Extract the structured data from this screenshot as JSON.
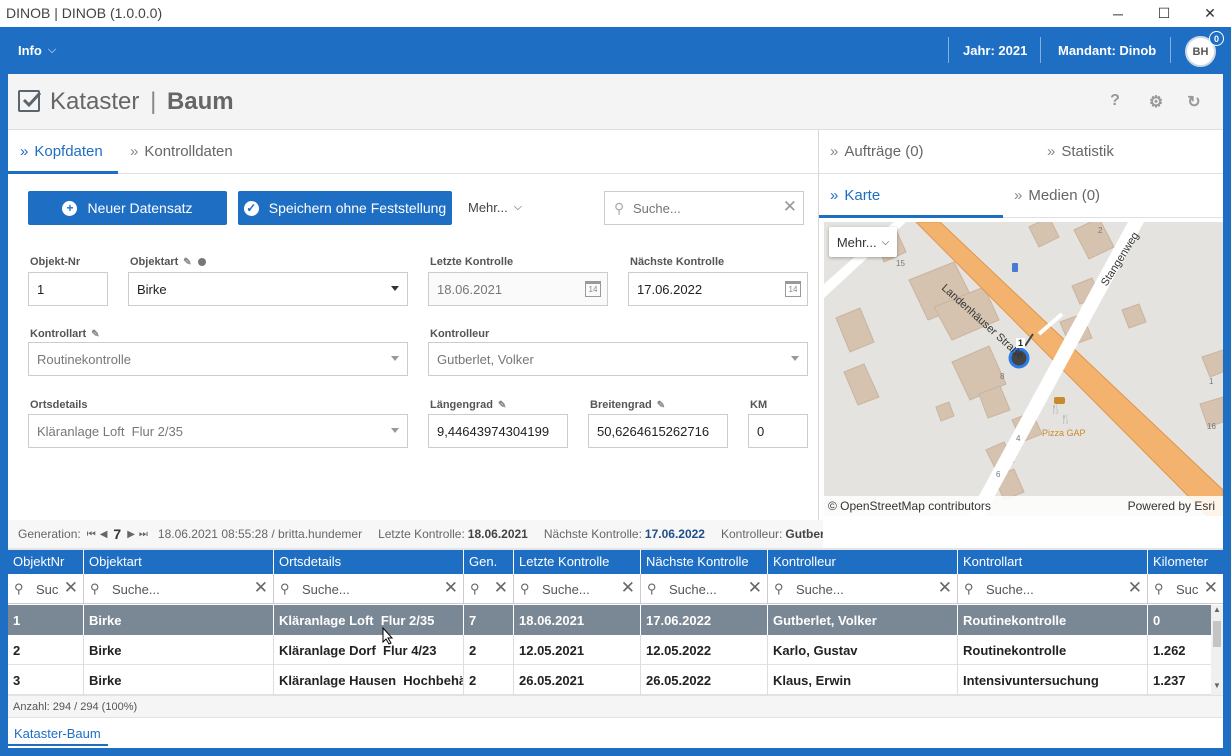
{
  "window": {
    "title": "DINOB | DINOB (1.0.0.0)",
    "minimize": "─",
    "maximize": "☐",
    "close": "✕"
  },
  "topnav": {
    "info": "Info",
    "jahr": "Jahr: 2021",
    "mandant": "Mandant: Dinob",
    "avatar": "BH",
    "badge": "0"
  },
  "header": {
    "title_left": "Kataster",
    "title_sep": "|",
    "title_right": "Baum",
    "help": "?",
    "settings": "⚙",
    "refresh": "↻"
  },
  "tabs": {
    "kopfdaten": "Kopfdaten",
    "kontrolldaten": "Kontrolldaten",
    "auftraege": "Aufträge (0)",
    "statistik": "Statistik",
    "karte": "Karte",
    "medien": "Medien (0)"
  },
  "toolbar": {
    "neu": "Neuer Datensatz",
    "speichern": "Speichern ohne Feststellung",
    "mehr": "Mehr...",
    "search_placeholder": "Suche..."
  },
  "form": {
    "objekt_nr": {
      "label": "Objekt-Nr",
      "value": "1"
    },
    "objektart": {
      "label": "Objektart",
      "value": "Birke"
    },
    "letzte_kontrolle": {
      "label": "Letzte Kontrolle",
      "value": "18.06.2021"
    },
    "naechste_kontrolle": {
      "label": "Nächste Kontrolle",
      "value": "17.06.2022"
    },
    "kontrollart": {
      "label": "Kontrollart",
      "value": "Routinekontrolle"
    },
    "kontrolleur": {
      "label": "Kontrolleur",
      "value": "Gutberlet, Volker"
    },
    "ortsdetails": {
      "label": "Ortsdetails",
      "value": "Kläranlage Loft  Flur 2/35"
    },
    "laengengrad": {
      "label": "Längengrad",
      "value": "9,44643974304199"
    },
    "breitengrad": {
      "label": "Breitengrad",
      "value": "50,6264615262716"
    },
    "km": {
      "label": "KM",
      "value": "0"
    }
  },
  "map": {
    "mehr": "Mehr...",
    "street1": "Landenhäuser Straße",
    "street2": "Stangenweg",
    "poi": "Pizza GAP",
    "marker_label": "1",
    "numbers": [
      "15",
      "2",
      "8",
      "4",
      "6",
      "16",
      "1"
    ],
    "attribution": "© OpenStreetMap contributors",
    "powered": "Powered by Esri"
  },
  "generation": {
    "label": "Generation:",
    "number": "7",
    "stamp": "18.06.2021 08:55:28 / britta.hundemer",
    "lk_label": "Letzte Kontrolle:",
    "lk_value": "18.06.2021",
    "nk_label": "Nächste Kontrolle:",
    "nk_value": "17.06.2022",
    "ko_label": "Kontrolleur:",
    "ko_value": "Gutberlet,"
  },
  "grid": {
    "columns": [
      "ObjektNr",
      "Objektart",
      "Ortsdetails",
      "Gen.",
      "Letzte Kontrolle",
      "Nächste Kontrolle",
      "Kontrolleur",
      "Kontrollart",
      "Kilometer"
    ],
    "filter_placeholders": [
      "Suc",
      "Suche...",
      "Suche...",
      "",
      "Suche...",
      "Suche...",
      "Suche...",
      "Suche...",
      "Suc"
    ],
    "rows": [
      [
        "1",
        "Birke",
        "Kläranlage Loft  Flur 2/35",
        "7",
        "18.06.2021",
        "17.06.2022",
        "Gutberlet, Volker",
        "Routinekontrolle",
        "0"
      ],
      [
        "2",
        "Birke",
        "Kläranlage Dorf  Flur 4/23",
        "2",
        "12.05.2021",
        "12.05.2022",
        "Karlo, Gustav",
        "Routinekontrolle",
        "1.262"
      ],
      [
        "3",
        "Birke",
        "Kläranlage Hausen  Hochbehält",
        "2",
        "26.05.2021",
        "26.05.2022",
        "Klaus, Erwin",
        "Intensivuntersuchung",
        "1.237"
      ]
    ],
    "count": "Anzahl: 294 / 294 (100%)"
  },
  "footer_tab": "Kataster-Baum"
}
